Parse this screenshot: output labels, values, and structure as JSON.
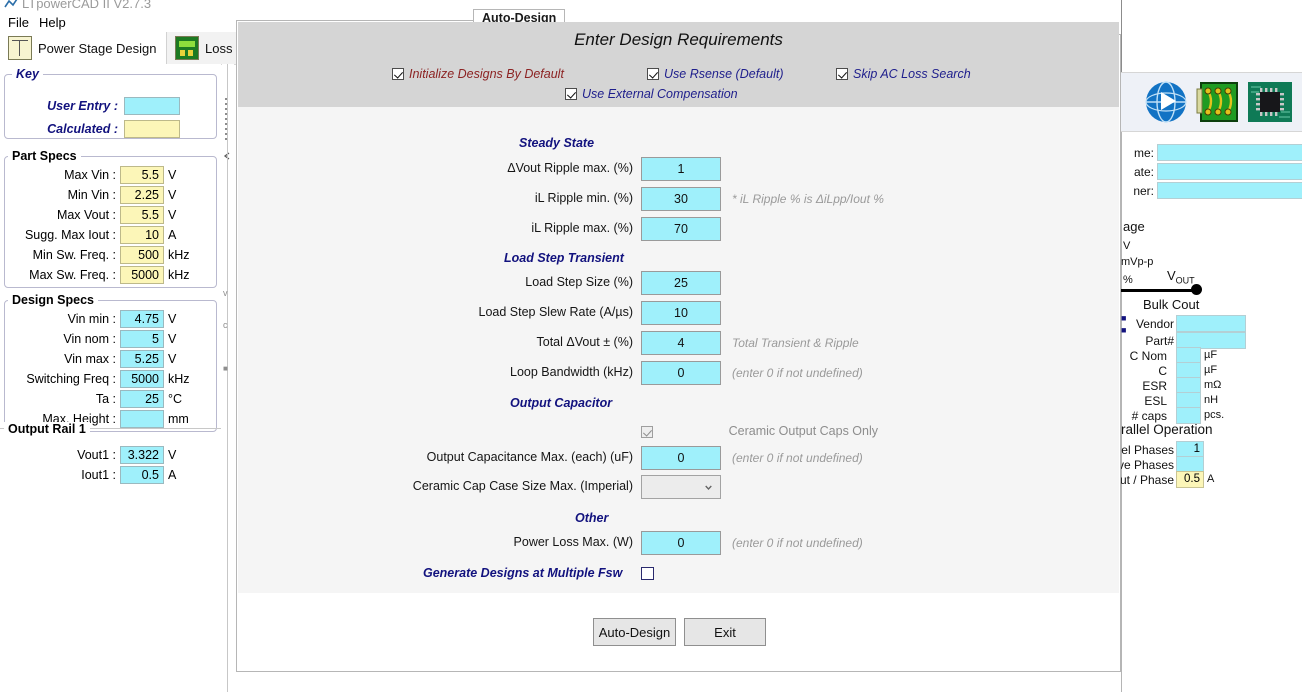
{
  "window": {
    "app_title": "LTpowerCAD II V2.7.3",
    "restore_icon": "restore-window-icon"
  },
  "menu": {
    "items": [
      {
        "label": "File",
        "name": "menu-file"
      },
      {
        "label": "Help",
        "name": "menu-help"
      }
    ]
  },
  "toolbar": {
    "buttons": [
      {
        "label": "Power Stage Design",
        "icon": "schematic-icon"
      },
      {
        "label": "Loss",
        "icon": "loss-chart-icon"
      }
    ]
  },
  "left_panel": {
    "key_group": {
      "title": "Key",
      "rows": [
        {
          "label": "User Entry :",
          "style": "user"
        },
        {
          "label": "Calculated :",
          "style": "calc"
        }
      ]
    },
    "part_specs": {
      "title": "Part Specs",
      "rows": [
        {
          "label": "Max Vin :",
          "value": "5.5",
          "unit": "V",
          "style": "calc"
        },
        {
          "label": "Min Vin :",
          "value": "2.25",
          "unit": "V",
          "style": "calc"
        },
        {
          "label": "Max Vout :",
          "value": "5.5",
          "unit": "V",
          "style": "calc"
        },
        {
          "label": "Sugg. Max Iout :",
          "value": "10",
          "unit": "A",
          "style": "calc"
        },
        {
          "label": "Min Sw. Freq. :",
          "value": "500",
          "unit": "kHz",
          "style": "calc"
        },
        {
          "label": "Max Sw. Freq. :",
          "value": "5000",
          "unit": "kHz",
          "style": "calc"
        }
      ]
    },
    "design_specs": {
      "title": "Design Specs",
      "rows": [
        {
          "label": "Vin min :",
          "value": "4.75",
          "unit": "V",
          "style": "user"
        },
        {
          "label": "Vin nom :",
          "value": "5",
          "unit": "V",
          "style": "user"
        },
        {
          "label": "Vin max :",
          "value": "5.25",
          "unit": "V",
          "style": "user"
        },
        {
          "label": "Switching Freq :",
          "value": "5000",
          "unit": "kHz",
          "style": "user"
        },
        {
          "label": "Ta :",
          "value": "25",
          "unit": "°C",
          "style": "user"
        },
        {
          "label": "Max. Height :",
          "value": "",
          "unit": "mm",
          "style": "user"
        }
      ]
    },
    "output_rail": {
      "title": "Output Rail 1",
      "rows": [
        {
          "label": "Vout1 :",
          "value": "3.322",
          "unit": "V",
          "style": "user"
        },
        {
          "label": "Iout1 :",
          "value": "0.5",
          "unit": "A",
          "style": "user"
        }
      ]
    }
  },
  "dialog": {
    "tab_label": "Auto-Design",
    "header_title": "Enter Design Requirements",
    "header_checkboxes": [
      {
        "label": "Initialize Designs By Default",
        "checked": true,
        "color": "red",
        "name": "initialize-designs-by-default-checkbox"
      },
      {
        "label": "Use Rsense (Default)",
        "checked": true,
        "color": "navy",
        "name": "use-rsense-checkbox"
      },
      {
        "label": "Skip AC Loss Search",
        "checked": true,
        "color": "navy",
        "name": "skip-ac-loss-search-checkbox"
      },
      {
        "label": "Use External Compensation",
        "checked": true,
        "color": "navy",
        "name": "use-external-compensation-checkbox"
      }
    ],
    "sections": {
      "steady_state": {
        "title": "Steady State",
        "fields": [
          {
            "label": "ΔVout Ripple max. (%)",
            "value": "1",
            "hint": "",
            "name": "vout-ripple-max-input"
          },
          {
            "label": "iL Ripple min. (%)",
            "value": "30",
            "hint": "* iL Ripple % is ΔiLpp/Iout %",
            "name": "il-ripple-min-input"
          },
          {
            "label": "iL Ripple max. (%)",
            "value": "70",
            "hint": "",
            "name": "il-ripple-max-input"
          }
        ]
      },
      "load_step_transient": {
        "title": "Load Step Transient",
        "fields": [
          {
            "label": "Load Step Size (%)",
            "value": "25",
            "hint": "",
            "name": "load-step-size-input"
          },
          {
            "label": "Load Step Slew Rate (A/µs)",
            "value": "10",
            "hint": "",
            "name": "load-step-slew-rate-input"
          },
          {
            "label": "Total ΔVout ± (%)",
            "value": "4",
            "hint": "Total Transient & Ripple",
            "name": "total-vout-input"
          },
          {
            "label": "Loop Bandwidth (kHz)",
            "value": "0",
            "hint": "(enter 0 if not undefined)",
            "name": "loop-bandwidth-input"
          }
        ]
      },
      "output_capacitor": {
        "title": "Output Capacitor",
        "ceramic_only": {
          "label": "Ceramic Output Caps Only",
          "checked": true,
          "disabled": true,
          "name": "ceramic-output-caps-only-checkbox"
        },
        "fields": [
          {
            "label": "Output Capacitance Max. (each) (uF)",
            "value": "0",
            "hint": "(enter 0 if not undefined)",
            "name": "output-capacitance-max-input"
          }
        ],
        "case_size": {
          "label": "Ceramic Cap Case Size Max. (Imperial)",
          "value": "",
          "name": "ceramic-cap-case-size-select"
        }
      },
      "other": {
        "title": "Other",
        "fields": [
          {
            "label": "Power Loss Max. (W)",
            "value": "0",
            "hint": "(enter 0 if not undefined)",
            "name": "power-loss-max-input"
          }
        ],
        "multi_fsw": {
          "label": "Generate Designs at Multiple Fsw",
          "checked": false,
          "name": "generate-designs-multiple-fsw-checkbox"
        }
      }
    },
    "buttons": [
      {
        "label": "Auto-Design",
        "name": "auto-design-button"
      },
      {
        "label": "Exit",
        "name": "exit-button"
      }
    ]
  },
  "right_panel": {
    "icons": [
      {
        "name": "globe-play-icon"
      },
      {
        "name": "pcb-board-icon"
      },
      {
        "name": "chip-package-icon"
      }
    ],
    "info_rows": [
      {
        "label": "me:",
        "value": ""
      },
      {
        "label": "ate:",
        "value": ""
      },
      {
        "label": "ner:",
        "value": ""
      }
    ],
    "voltage_block": {
      "heading": "age",
      "units": [
        "V",
        "mVp-p",
        "%"
      ]
    },
    "vout_node_label": "V",
    "vout_node_sub": "OUT",
    "bulk_cout": {
      "title": "Bulk Cout",
      "rows": [
        {
          "label": "Vendor",
          "value": "",
          "unit": ""
        },
        {
          "label": "Part#",
          "value": "",
          "unit": ""
        },
        {
          "label": "C Nom",
          "value": "",
          "unit": "µF"
        },
        {
          "label": "C",
          "value": "",
          "unit": "µF"
        },
        {
          "label": "ESR",
          "value": "",
          "unit": "mΩ"
        },
        {
          "label": "ESL",
          "value": "",
          "unit": "nH"
        },
        {
          "label": "# caps",
          "value": "",
          "unit": "pcs."
        }
      ]
    },
    "parallel_operation": {
      "title": "rallel Operation",
      "rows": [
        {
          "label": "llel Phases",
          "value": "1",
          "unit": "",
          "style": "user"
        },
        {
          "label": "ve Phases",
          "value": "",
          "unit": "",
          "style": "user"
        },
        {
          "label": "out / Phase",
          "value": "0.5",
          "unit": "A",
          "style": "calc"
        }
      ]
    }
  },
  "colors": {
    "user_entry": "#9ff0fb",
    "calculated": "#fcf6b8",
    "section_heading": "#12127e",
    "header_band": "#d5d5d5",
    "red_label": "#8c2323"
  }
}
